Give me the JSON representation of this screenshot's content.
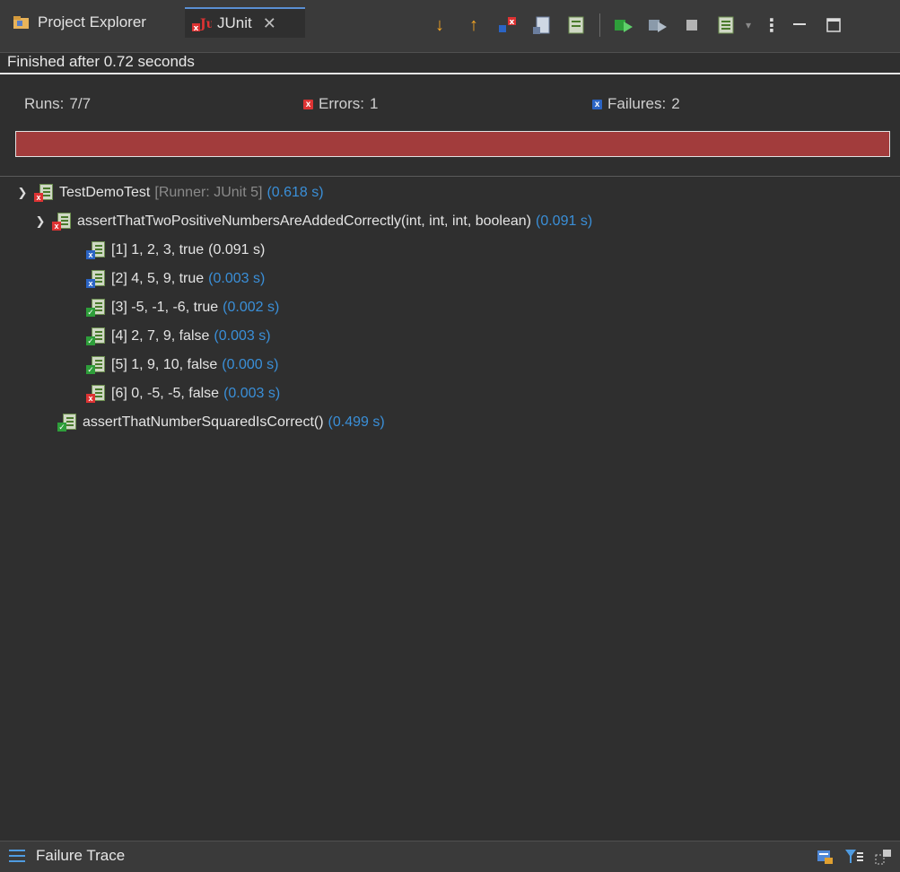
{
  "tabs": [
    {
      "label": "Project Explorer",
      "icon": "project-explorer-icon"
    },
    {
      "label": "JUnit",
      "icon": "junit-icon",
      "close": "✕"
    }
  ],
  "status": "Finished after 0.72 seconds",
  "counters": {
    "runs_label": "Runs:",
    "runs_value": "7/7",
    "errors_label": "Errors:",
    "errors_value": "1",
    "failures_label": "Failures:",
    "failures_value": "2"
  },
  "progress": {
    "fraction": 1.0,
    "color": "#a23c3c"
  },
  "tree": {
    "root": {
      "name": "TestDemoTest",
      "meta": "[Runner: JUnit 5]",
      "time": "(0.618 s)"
    },
    "method1": {
      "name": "assertThatTwoPositiveNumbersAreAddedCorrectly(int, int, int, boolean)",
      "time": "(0.091 s)"
    },
    "cases": [
      {
        "name": "[1] 1, 2, 3, true",
        "time": "(0.091 s)",
        "status": "failure"
      },
      {
        "name": "[2] 4, 5, 9, true",
        "time": "(0.003 s)",
        "status": "failure"
      },
      {
        "name": "[3] -5, -1, -6, true",
        "time": "(0.002 s)",
        "status": "ok"
      },
      {
        "name": "[4] 2, 7, 9, false",
        "time": "(0.003 s)",
        "status": "ok"
      },
      {
        "name": "[5] 1, 9, 10, false",
        "time": "(0.000 s)",
        "status": "ok"
      },
      {
        "name": "[6] 0, -5, -5, false",
        "time": "(0.003 s)",
        "status": "error"
      }
    ],
    "method2": {
      "name": "assertThatNumberSquaredIsCorrect()",
      "time": "(0.499 s)"
    }
  },
  "bottom": {
    "label": "Failure Trace"
  },
  "colors": {
    "accent": "#3a8fd8",
    "error": "#d33333",
    "failure": "#2b64c4",
    "ok": "#2e9e3a"
  }
}
